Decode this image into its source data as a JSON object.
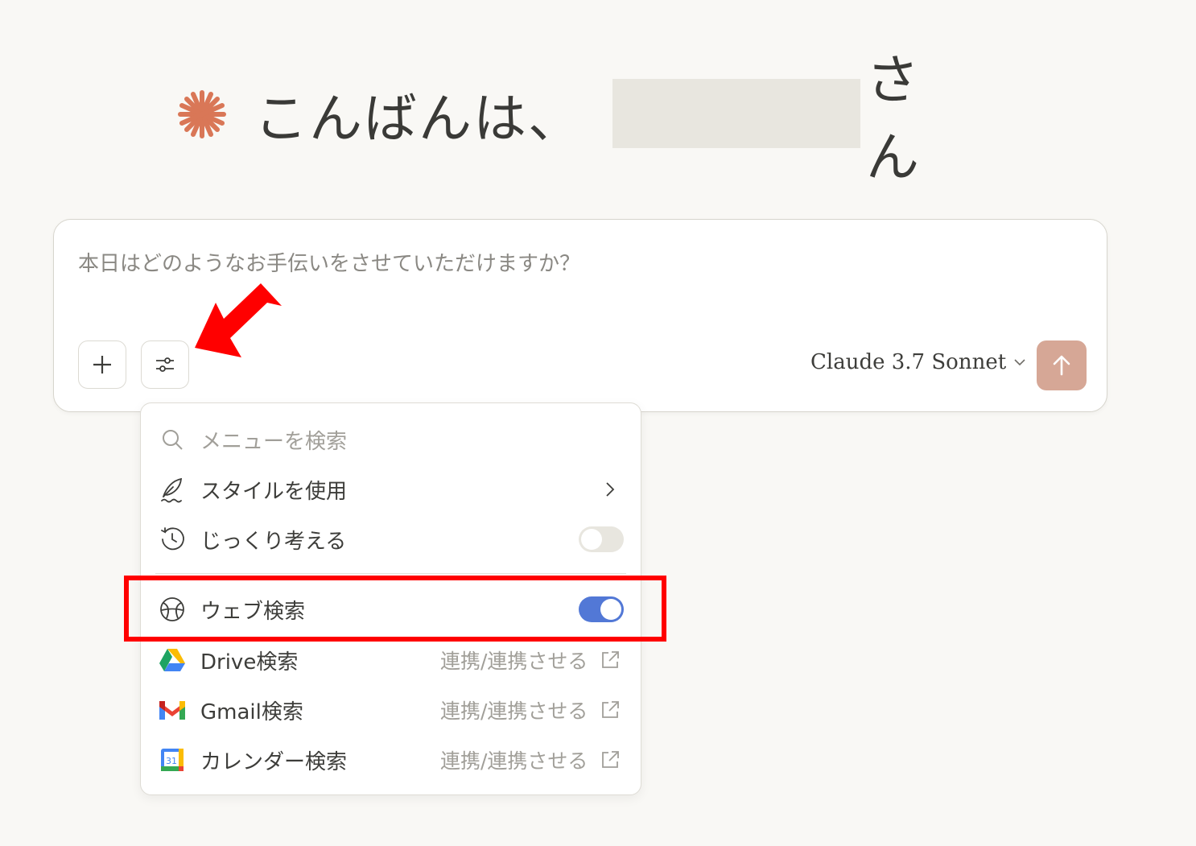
{
  "greeting": {
    "text": "こんばんは、",
    "suffix": "さん"
  },
  "composer": {
    "placeholder": "本日はどのようなお手伝いをさせていただけますか？",
    "model": "Claude 3.7 Sonnet"
  },
  "menu": {
    "search_placeholder": "メニューを検索",
    "items": [
      {
        "label": "スタイルを使用",
        "icon": "quill-icon",
        "control": "chevron"
      },
      {
        "label": "じっくり考える",
        "icon": "clock-icon",
        "control": "toggle",
        "enabled": false
      },
      {
        "label": "ウェブ検索",
        "icon": "globe-icon",
        "control": "toggle",
        "enabled": true
      },
      {
        "label": "Drive検索",
        "icon": "google-drive-icon",
        "hint": "連携/連携させる"
      },
      {
        "label": "Gmail検索",
        "icon": "gmail-icon",
        "hint": "連携/連携させる"
      },
      {
        "label": "カレンダー検索",
        "icon": "google-calendar-icon",
        "hint": "連携/連携させる",
        "calendar_day": "31"
      }
    ]
  },
  "colors": {
    "accent": "#d97757",
    "send_button": "#d6a796",
    "toggle_on": "#5278d6",
    "annotation": "#ff0000"
  }
}
